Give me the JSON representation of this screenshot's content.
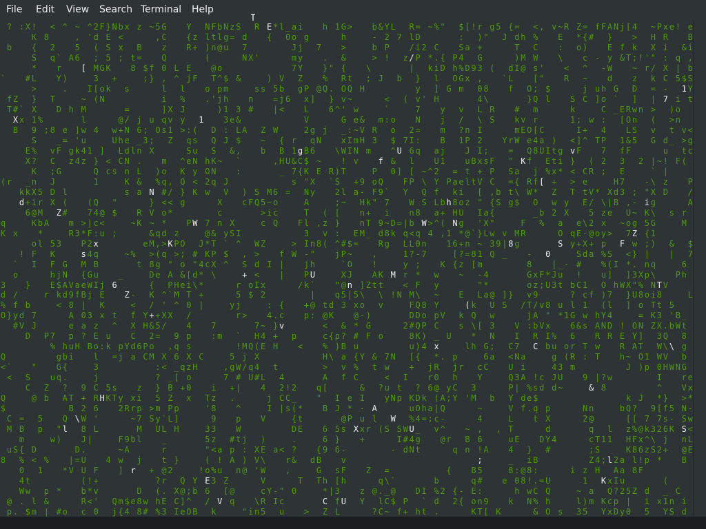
{
  "menu": [
    "File",
    "Edit",
    "View",
    "Search",
    "Terminal",
    "Help"
  ],
  "colors": {
    "menubar": "#2e3436",
    "terminal_bg": "#2e3436",
    "matrix_green": "#4e9a06",
    "highlight_white": "#eeeeec"
  },
  "terminal": {
    "cols": 112,
    "rows": 48,
    "seed": 7,
    "charset": "ABCDEFGHIJKLMNOPQRSTUVWXYZabcdefghijklmnopqrstuvwxyz0123456789!@#$%^&*()_+-=[]{};:'\",.<>/?\\|`~",
    "white_chars": [
      {
        "col": 2,
        "row": 9,
        "ch": "X"
      },
      {
        "col": 3,
        "row": 17,
        "ch": "d"
      },
      {
        "col": 9,
        "row": 18,
        "ch": "Z"
      },
      {
        "col": 10,
        "row": 39,
        "ch": "l"
      },
      {
        "col": 13,
        "row": 4,
        "ch": "["
      },
      {
        "col": 13,
        "row": 22,
        "ch": "s"
      },
      {
        "col": 12,
        "row": 38,
        "ch": "\\"
      },
      {
        "col": 15,
        "row": 21,
        "ch": "x"
      },
      {
        "col": 16,
        "row": 36,
        "ch": "H"
      },
      {
        "col": 18,
        "row": 25,
        "ch": "6"
      },
      {
        "col": 20,
        "row": 26,
        "ch": "Z"
      },
      {
        "col": 21,
        "row": 43,
        "ch": "r"
      },
      {
        "col": 24,
        "row": 16,
        "ch": "N"
      },
      {
        "col": 24,
        "row": 28,
        "ch": "+"
      },
      {
        "col": 27,
        "row": 21,
        "ch": "K"
      },
      {
        "col": 31,
        "row": 19,
        "ch": "W"
      },
      {
        "col": 32,
        "row": 9,
        "ch": "1"
      },
      {
        "col": 33,
        "row": 44,
        "ch": "E"
      },
      {
        "col": 35,
        "row": 46,
        "ch": "V"
      },
      {
        "col": 39,
        "row": 24,
        "ch": "+"
      },
      {
        "col": 43,
        "row": 0,
        "ch": "E"
      },
      {
        "col": 45,
        "row": 29,
        "ch": "v"
      },
      {
        "col": 48,
        "row": 12,
        "ch": "g"
      },
      {
        "col": 50,
        "row": 24,
        "ch": "U"
      },
      {
        "col": 52,
        "row": 46,
        "ch": "C"
      },
      {
        "col": 55,
        "row": 46,
        "ch": "U"
      },
      {
        "col": 56,
        "row": 25,
        "ch": "n"
      },
      {
        "col": 57,
        "row": 39,
        "ch": "X"
      },
      {
        "col": 60,
        "row": 37,
        "ch": "A"
      },
      {
        "col": 61,
        "row": 13,
        "ch": "f"
      },
      {
        "col": 63,
        "row": 24,
        "ch": "M"
      },
      {
        "col": 63,
        "row": 38,
        "ch": "W"
      },
      {
        "col": 64,
        "row": 12,
        "ch": "U"
      },
      {
        "col": 66,
        "row": 3,
        "ch": "/"
      },
      {
        "col": 66,
        "row": 39,
        "ch": "U"
      },
      {
        "col": 68,
        "row": 19,
        "ch": "W"
      },
      {
        "col": 70,
        "row": 31,
        "ch": "x"
      },
      {
        "col": 72,
        "row": 17,
        "ch": "h"
      },
      {
        "col": 73,
        "row": 19,
        "ch": "N"
      },
      {
        "col": 75,
        "row": 27,
        "ch": "("
      },
      {
        "col": 77,
        "row": 42,
        "ch": ";"
      },
      {
        "col": 82,
        "row": 21,
        "ch": "8"
      },
      {
        "col": 84,
        "row": 13,
        "ch": "K"
      },
      {
        "col": 86,
        "row": 31,
        "ch": "C"
      },
      {
        "col": 87,
        "row": 15,
        "ch": "["
      },
      {
        "col": 88,
        "row": 22,
        "ch": "0"
      },
      {
        "col": 90,
        "row": 21,
        "ch": "S"
      },
      {
        "col": 92,
        "row": 12,
        "ch": "v"
      },
      {
        "col": 95,
        "row": 35,
        "ch": "&"
      },
      {
        "col": 97,
        "row": 44,
        "ch": "K"
      },
      {
        "col": 98,
        "row": 42,
        "ch": "l"
      },
      {
        "col": 100,
        "row": 21,
        "ch": "F"
      },
      {
        "col": 102,
        "row": 20,
        "ch": "Z"
      },
      {
        "col": 104,
        "row": 17,
        "ch": "i"
      },
      {
        "col": 106,
        "row": 25,
        "ch": "T"
      },
      {
        "col": 107,
        "row": 7,
        "ch": "7"
      },
      {
        "col": 108,
        "row": 31,
        "ch": "\\"
      },
      {
        "col": 110,
        "row": 6,
        "ch": "1"
      },
      {
        "col": 110,
        "row": 39,
        "ch": "S"
      }
    ]
  }
}
